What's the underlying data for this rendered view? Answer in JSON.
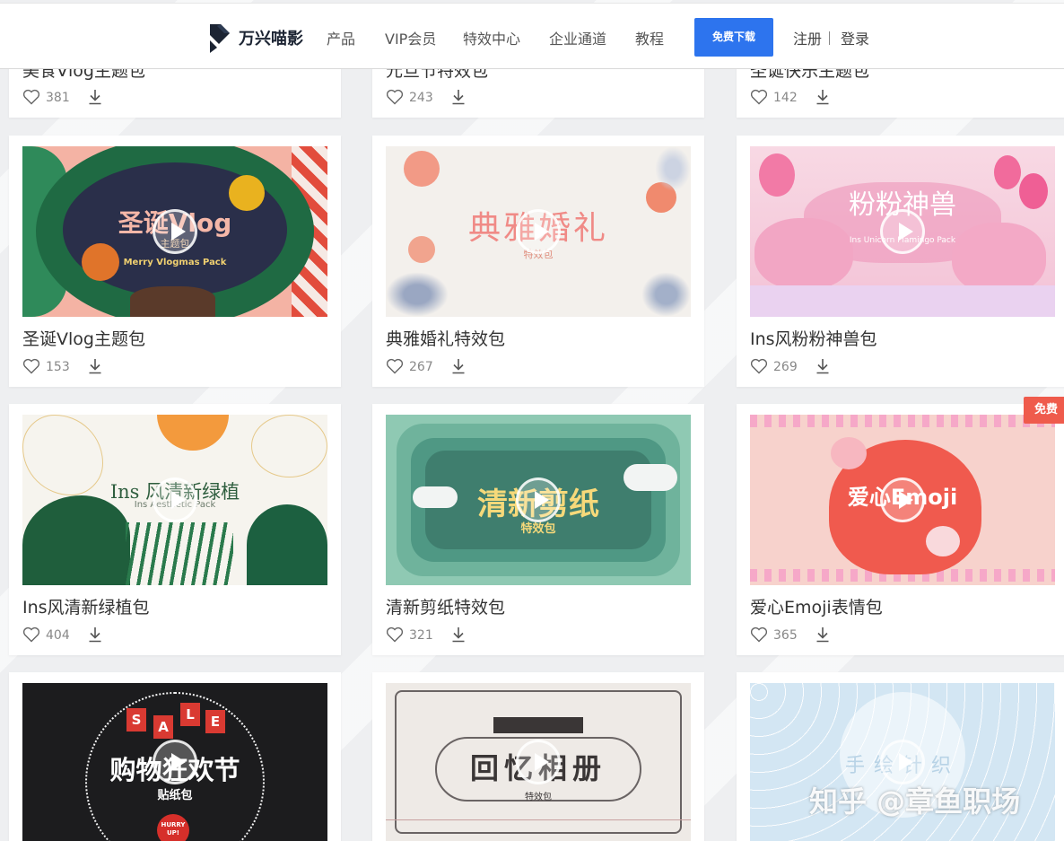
{
  "header": {
    "logo_text": "万兴喵影",
    "nav": [
      "产品",
      "VIP会员",
      "特效中心",
      "企业通道",
      "教程"
    ],
    "download_label": "免费下载",
    "register_label": "注册",
    "login_label": "登录"
  },
  "top_row": [
    {
      "title": "美食Vlog主题包",
      "likes": "381"
    },
    {
      "title": "元旦节特效包",
      "likes": "243"
    },
    {
      "title": "圣诞快乐主题包",
      "likes": "142"
    }
  ],
  "cards": [
    {
      "title": "圣诞Vlog主题包",
      "likes": "153",
      "thumb_main": "圣诞Vlog",
      "thumb_sub": "主题包",
      "thumb_sub2": "Merry Vlogmas Pack"
    },
    {
      "title": "典雅婚礼特效包",
      "likes": "267",
      "thumb_main": "典雅婚礼",
      "thumb_sub": "特效包"
    },
    {
      "title": "Ins风粉粉神兽包",
      "likes": "269",
      "thumb_main": "粉粉神兽",
      "thumb_sub": "Ins Unicorn Flamingo Pack"
    },
    {
      "title": "Ins风清新绿植包",
      "likes": "404",
      "thumb_main": "Ins 风清新绿植",
      "thumb_sub": "Ins Aesthetic Pack"
    },
    {
      "title": "清新剪纸特效包",
      "likes": "321",
      "thumb_main": "清新剪纸",
      "thumb_sub": "特效包"
    },
    {
      "title": "爱心Emoji表情包",
      "likes": "365",
      "thumb_main": "爱心Emoji",
      "badge": "免费"
    }
  ],
  "bottom_row": [
    {
      "thumb_main": "购物狂欢节",
      "thumb_sub": "贴纸包",
      "sale_letters": [
        "S",
        "A",
        "L",
        "E"
      ],
      "hurry": "HURRY UP!"
    },
    {
      "thumb_main": "回忆相册",
      "thumb_sub": "特效包"
    },
    {
      "thumb_main": "手绘针织"
    }
  ],
  "watermark": "知乎 @章鱼职场",
  "colors": {
    "accent": "#2d74ee",
    "badge": "#ef5b4c"
  },
  "icons": {
    "like": "heart-outline-icon",
    "download": "download-arrow-icon",
    "play": "play-circle-icon"
  }
}
